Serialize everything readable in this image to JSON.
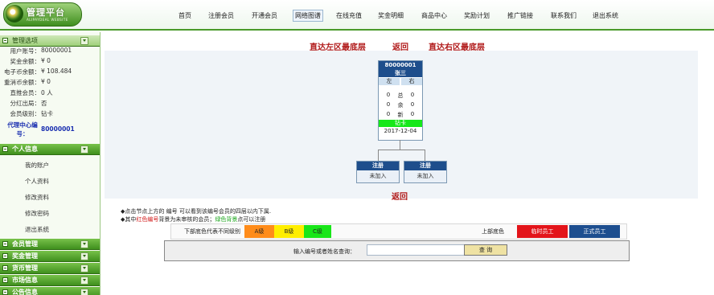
{
  "brand": {
    "title": "管理平台",
    "subtitle": "ALIPAYDEAL WEBSITE"
  },
  "nav": [
    "首页",
    "注册会员",
    "开通会员",
    "网络图谱",
    "在线充值",
    "奖金明细",
    "商品中心",
    "奖励计划",
    "推广链接",
    "联系我们",
    "退出系统"
  ],
  "sidebar": {
    "admin_title": "管理选项",
    "info": [
      {
        "k": "用户账号：",
        "v": "80000001"
      },
      {
        "k": "奖金余额：",
        "v": "¥ 0"
      },
      {
        "k": "电子币余额：",
        "v": "¥ 108.484"
      },
      {
        "k": "重消币余额：",
        "v": "¥ 0"
      },
      {
        "k": "直推会员：",
        "v": "0 人"
      },
      {
        "k": "分红出局：",
        "v": "否"
      },
      {
        "k": "会员级别：",
        "v": "钻卡"
      }
    ],
    "agent_label": "代理中心编号：",
    "agent_value": "80000001",
    "personal_title": "个人信息",
    "personal_items": [
      "我的账户",
      "个人资料",
      "修改资料",
      "修改密码",
      "退出系统"
    ],
    "sections": [
      "会员管理",
      "奖金管理",
      "货币管理",
      "市场信息",
      "公告信息"
    ]
  },
  "tree": {
    "left_link": "直达左区最底层",
    "back_link": "返回",
    "right_link": "直达右区最底层",
    "root": {
      "id": "80000001",
      "name": "张三",
      "left_label": "左",
      "right_label": "右",
      "rows": [
        {
          "l": "0",
          "m": "总",
          "r": "0"
        },
        {
          "l": "0",
          "m": "余",
          "r": "0"
        },
        {
          "l": "0",
          "m": "新",
          "r": "0"
        }
      ],
      "rank": "钻卡",
      "date": "2017-12-04"
    },
    "children": [
      {
        "title": "注册",
        "status": "未加入"
      },
      {
        "title": "注册",
        "status": "未加入"
      }
    ],
    "bottom_back": "返回"
  },
  "notes": {
    "line1": "◆点击节点上方的  编号  可以看到该编号会员的四层以内下属.",
    "line2_a": "◆其中",
    "line2_b": "红色编号",
    "line2_c": "背景为未审核的会员；",
    "line2_d": "绿色背景",
    "line2_e": "点可以注册"
  },
  "legend": {
    "label": "下部底色代表不同级别",
    "levels": [
      {
        "name": "A级",
        "color": "#ff8c1a"
      },
      {
        "name": "B级",
        "color": "#ffee00"
      },
      {
        "name": "C级",
        "color": "#19e619"
      }
    ],
    "label2": "上部底色",
    "types": [
      {
        "name": "临时员工",
        "color": "#e3141a",
        "text": "#ffffff"
      },
      {
        "name": "正式员工",
        "color": "#1d4e8f",
        "text": "#ffffff"
      }
    ]
  },
  "search": {
    "label": "输入编号或者姓名查询：",
    "value": "",
    "button": "查 询"
  }
}
